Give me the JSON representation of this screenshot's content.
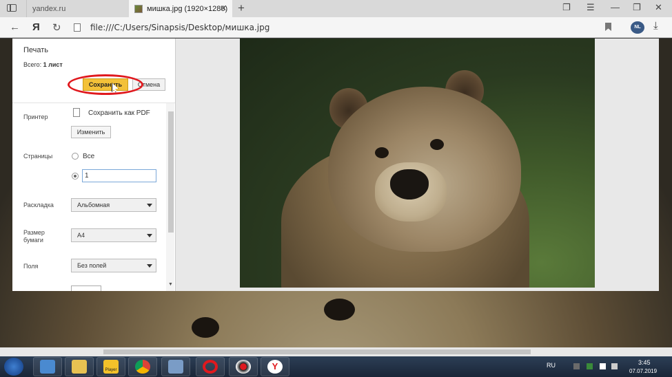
{
  "browser": {
    "tabs": [
      {
        "label": "yandex.ru",
        "active": false
      },
      {
        "label": "мишка.jpg (1920×1280)",
        "active": true
      }
    ],
    "address": "file:///C:/Users/Sinapsis/Desktop/мишка.jpg",
    "ext_badge": "NL",
    "yandex_button": "Я"
  },
  "print_panel": {
    "title": "Печать",
    "total_prefix": "Всего:",
    "total_value": "1 лист",
    "save_button": "Сохранить",
    "cancel_button": "Отмена",
    "printer_label": "Принтер",
    "printer_value": "Сохранить как PDF",
    "change_button": "Изменить",
    "pages_label": "Страницы",
    "pages_all": "Все",
    "pages_custom_value": "1",
    "layout_label": "Раскладка",
    "layout_value": "Альбомная",
    "paper_label": "Размер бумаги",
    "paper_value": "A4",
    "margins_label": "Поля",
    "margins_value": "Без полей"
  },
  "taskbar": {
    "player_label": "Player",
    "lang": "RU",
    "time": "3:45",
    "date": "07.07.2019"
  },
  "colors": {
    "save_button": "#f3c138",
    "highlight_ring": "#e0191e",
    "taskbar": "#1f2d42"
  }
}
